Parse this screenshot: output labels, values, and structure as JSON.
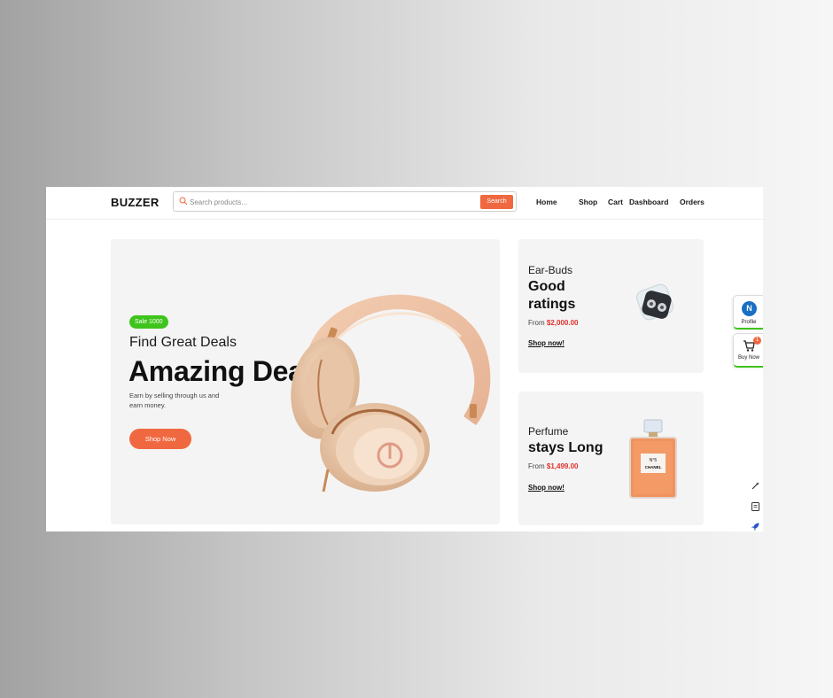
{
  "header": {
    "logo": "BUZZER",
    "search": {
      "placeholder": "Search products...",
      "value": "",
      "button_label": "Search"
    },
    "nav": [
      {
        "label": "Home"
      },
      {
        "label": "Shop"
      },
      {
        "label": "Cart"
      },
      {
        "label": "Dashboard"
      },
      {
        "label": "Orders"
      }
    ]
  },
  "hero": {
    "badge": "Sale 1000",
    "subtitle": "Find Great Deals",
    "title": "Amazing Deal",
    "description": "Earn by selling through us and earn money.",
    "button_label": "Shop Now"
  },
  "promos": [
    {
      "category": "Ear-Buds",
      "tagline_1": "Good",
      "tagline_2": "ratings",
      "price_prefix": "From",
      "price": "$2,000.00",
      "link": "Shop now!"
    },
    {
      "category": "Perfume",
      "tagline_1": "stays Long",
      "price_prefix": "From",
      "price": "$1,499.00",
      "link": "Shop now!",
      "bottle_label_1": "N°5",
      "bottle_label_2": "CHANEL"
    }
  ],
  "side_widgets": {
    "profile": {
      "avatar_letter": "N",
      "label": "Profile"
    },
    "cart": {
      "count": "1",
      "label": "Buy Now"
    }
  },
  "colors": {
    "accent": "#f0683f",
    "badge_green": "#3fc41c",
    "price_red": "#e0312c",
    "avatar_blue": "#1a6fc4"
  },
  "icons": [
    "search-icon",
    "cart-icon",
    "magic-wand-icon",
    "clipboard-icon",
    "rocket-icon"
  ]
}
